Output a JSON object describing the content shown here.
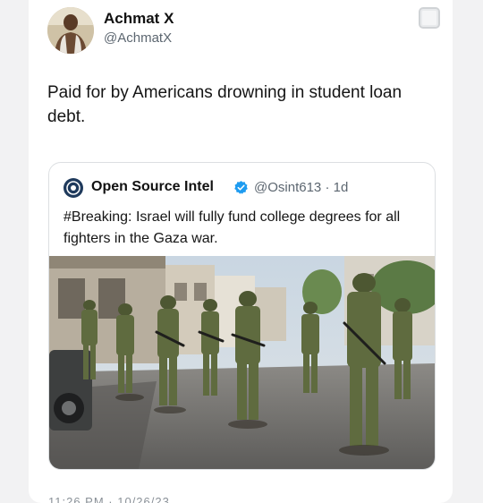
{
  "tweet": {
    "author_name": "Achmat X",
    "author_handle": "@AchmatX",
    "text": "Paid for by Americans drowning in student loan debt.",
    "timestamp": "11:26 PM · 10/26/23"
  },
  "quoted_tweet": {
    "author_name": "Open Source Intel",
    "author_handle": "@Osint613",
    "age": "1d",
    "text": "#Breaking: Israel will fully fund college degrees for all fighters in the Gaza war."
  },
  "icons": {
    "avatar": "user-avatar-photo",
    "quoted_avatar": "osint-logo-icon",
    "verified": "verified-badge-icon",
    "corner": "checkbox-icon"
  },
  "colors": {
    "verified_blue": "#1d9bf0",
    "handle_gray": "#5c6670"
  }
}
